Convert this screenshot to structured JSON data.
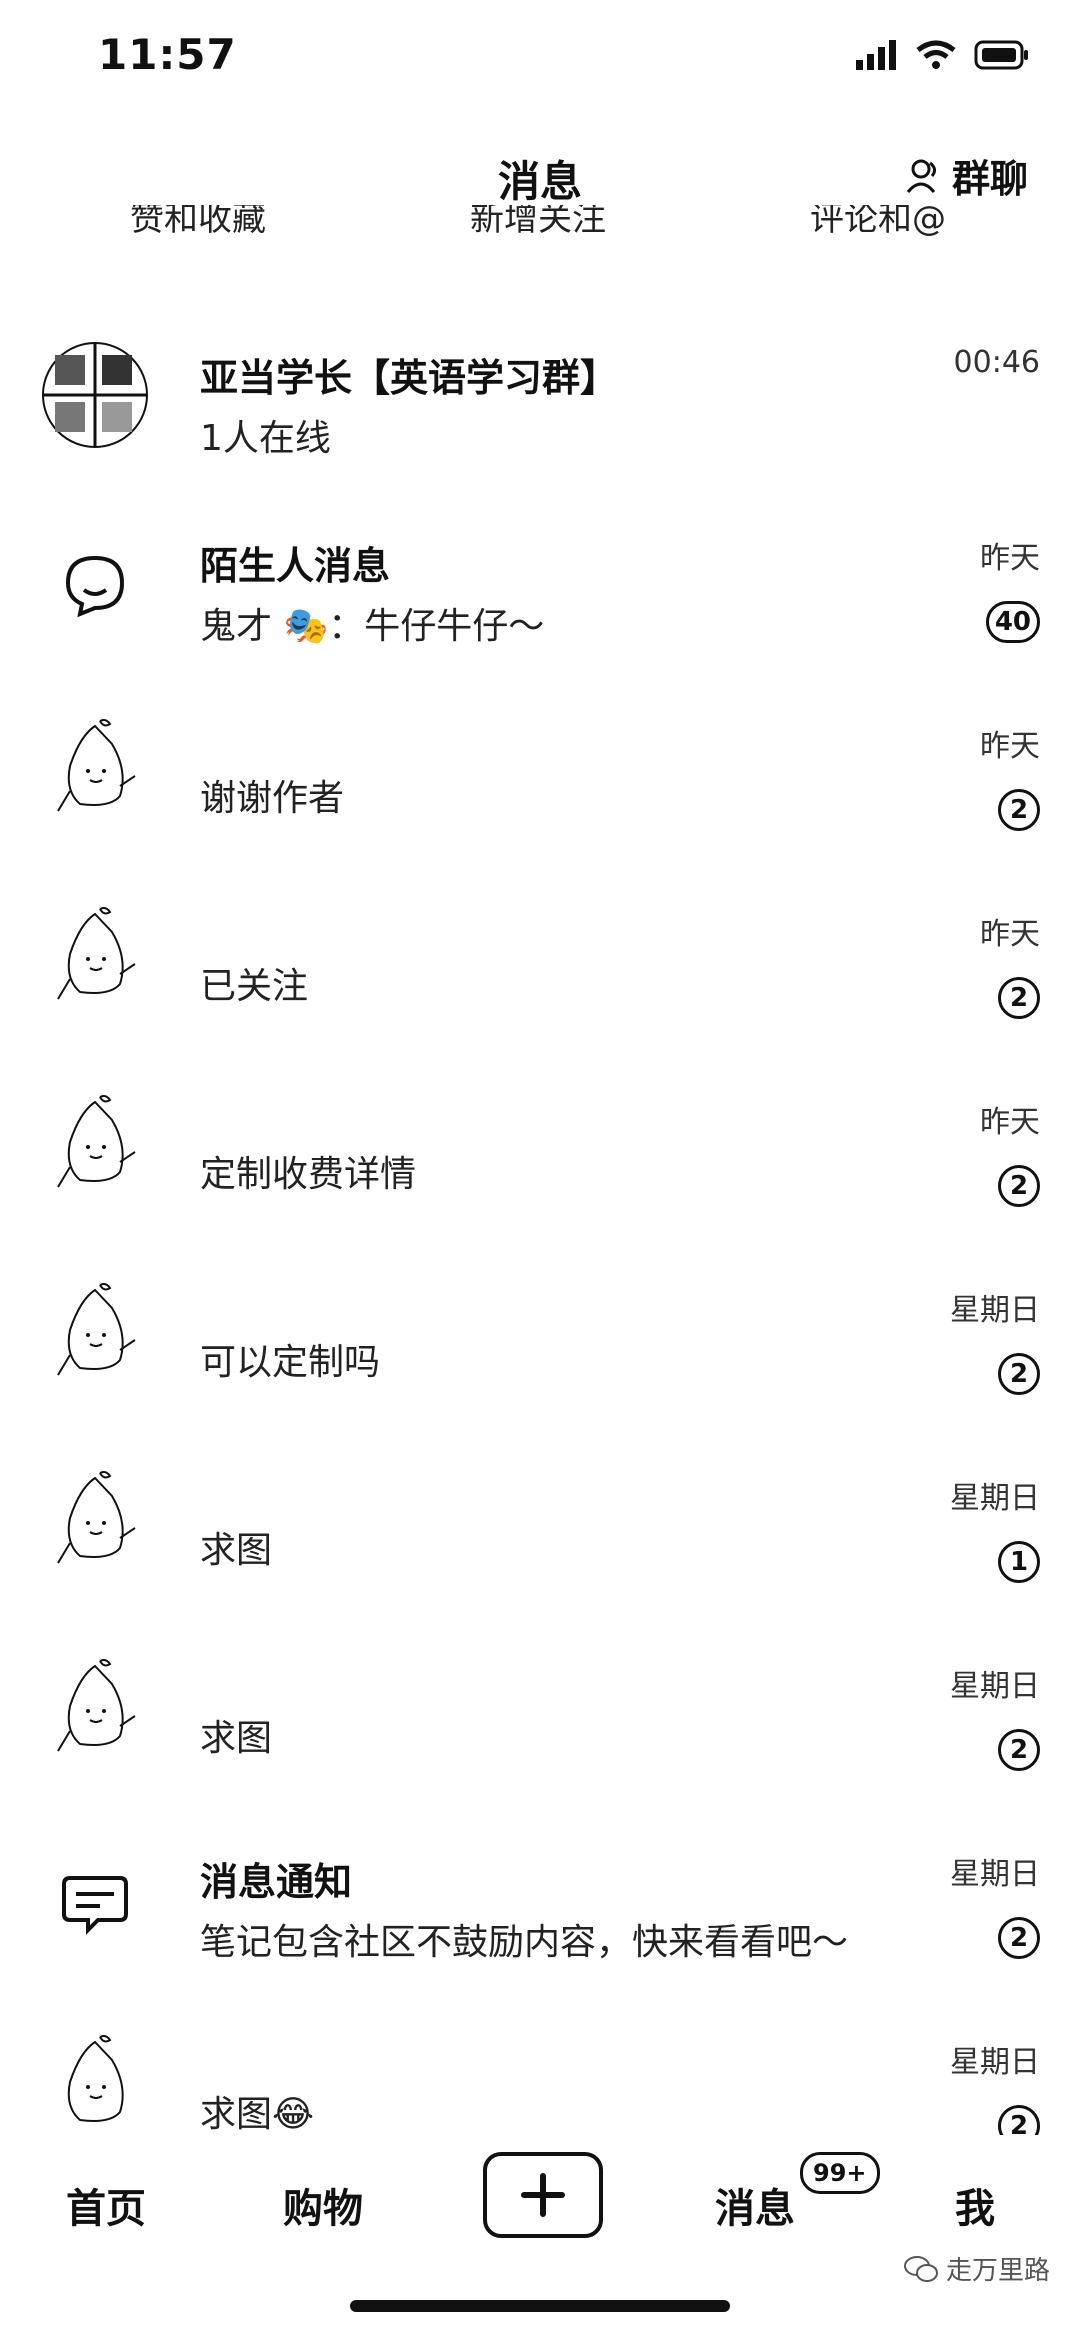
{
  "status_bar": {
    "time": "11:57"
  },
  "header": {
    "title": "消息",
    "group_chat_label": "群聊"
  },
  "quick_actions": [
    "赞和收藏",
    "新增关注",
    "评论和@"
  ],
  "conversations": [
    {
      "name": "亚当学长【英语学习群】",
      "preview": "1人在线",
      "time": "00:46",
      "badge": "",
      "avatar": "group-collage"
    },
    {
      "name": "陌生人消息",
      "preview": "鬼才 🎭：牛仔牛仔～",
      "time": "昨天",
      "badge": "40",
      "avatar": "chat-bubble-icon"
    },
    {
      "name": "",
      "preview": "谢谢作者",
      "time": "昨天",
      "badge": "2",
      "avatar": "cartoon"
    },
    {
      "name": "",
      "preview": "已关注",
      "time": "昨天",
      "badge": "2",
      "avatar": "cartoon"
    },
    {
      "name": "",
      "preview": "定制收费详情",
      "time": "昨天",
      "badge": "2",
      "avatar": "cartoon"
    },
    {
      "name": "",
      "preview": "可以定制吗",
      "time": "星期日",
      "badge": "2",
      "avatar": "cartoon"
    },
    {
      "name": "",
      "preview": "求图",
      "time": "星期日",
      "badge": "1",
      "avatar": "cartoon"
    },
    {
      "name": "",
      "preview": "求图",
      "time": "星期日",
      "badge": "2",
      "avatar": "cartoon"
    },
    {
      "name": "消息通知",
      "preview": "笔记包含社区不鼓励内容，快来看看吧～",
      "time": "星期日",
      "badge": "2",
      "avatar": "notice-icon"
    },
    {
      "name": "",
      "preview": "求图😂",
      "time": "星期日",
      "badge": "2",
      "avatar": "cartoon"
    }
  ],
  "tab_bar": {
    "home": "首页",
    "shop": "购物",
    "messages": "消息",
    "messages_badge": "99+",
    "me": "我"
  },
  "watermark": "走万里路"
}
